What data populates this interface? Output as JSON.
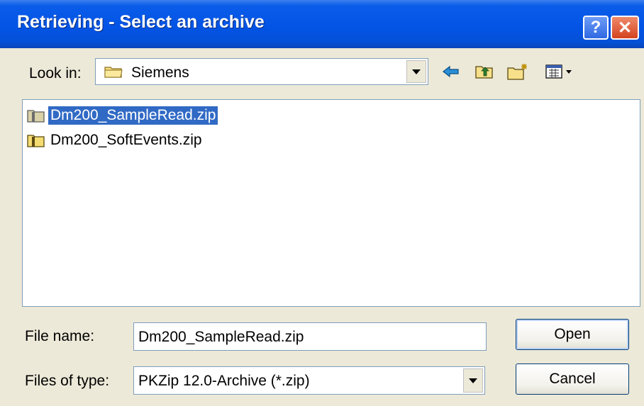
{
  "window": {
    "title": "Retrieving - Select an archive",
    "help_glyph": "?",
    "close_glyph": "✕"
  },
  "lookin": {
    "label": "Look in:",
    "value": "Siemens"
  },
  "toolbar": {
    "icons": [
      "back-arrow-icon",
      "up-one-level-icon",
      "new-folder-icon",
      "view-menu-icon"
    ]
  },
  "files": [
    {
      "name": "Dm200_SampleRead.zip",
      "selected": true
    },
    {
      "name": "Dm200_SoftEvents.zip",
      "selected": false
    }
  ],
  "filename": {
    "label": "File name:",
    "value": "Dm200_SampleRead.zip"
  },
  "filetype": {
    "label": "Files of type:",
    "value": "PKZip 12.0-Archive (*.zip)"
  },
  "buttons": {
    "open": "Open",
    "cancel": "Cancel"
  },
  "colors": {
    "titlebar": "#0354e6",
    "selection": "#316ac5",
    "dialog_bg": "#ece9d8"
  }
}
